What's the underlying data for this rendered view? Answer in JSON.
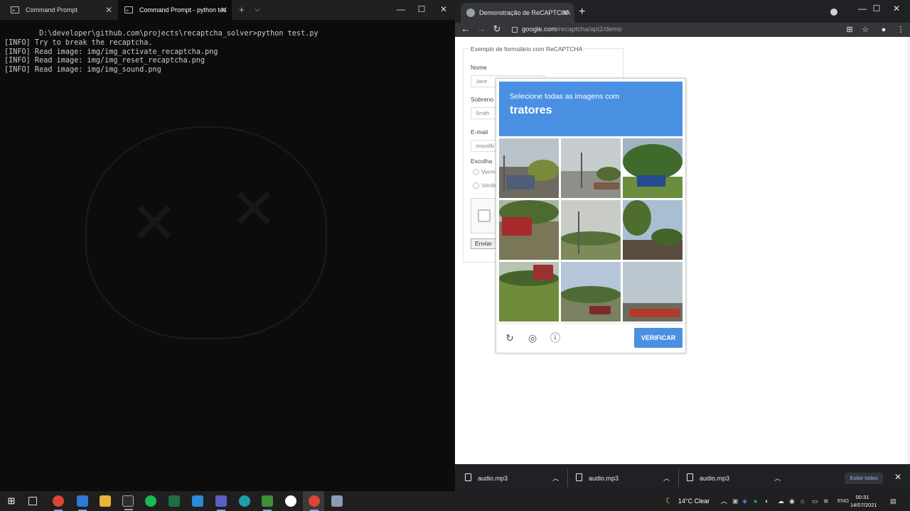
{
  "terminal": {
    "tabs": [
      {
        "label": "Command Prompt"
      },
      {
        "label": "Command Prompt - python  tes"
      }
    ],
    "lines": [
      "        D:\\developer\\github.com\\projects\\recaptcha_solver>python test.py",
      "[INFO] Try to break the recaptcha.",
      "[INFO] Read image: img/img_activate_recaptcha.png",
      "[INFO] Read image: img/img_reset_recaptcha.png",
      "[INFO] Read image: img/img_sound.png"
    ]
  },
  "browser": {
    "tab_title": "Demonstração de ReCAPTCHA",
    "url_host": "google.com",
    "url_path": "/recaptcha/api2/demo",
    "form": {
      "legend": "Exemplo de formulário com ReCAPTCHA",
      "name_label": "Nome",
      "name_value": "Jane",
      "surname_label": "Sobreno",
      "surname_value": "Smith",
      "email_label": "E-mail",
      "email_value": "stopallb",
      "choice_label": "Escolha",
      "radio1": "Verm",
      "radio2": "Verde",
      "submit": "Enviar"
    },
    "captcha": {
      "instruction": "Selecione todas as imagens com",
      "target": "tratores",
      "verify_label": "VERIFICAR",
      "accent": "#4a90e2"
    },
    "downloads": [
      {
        "name": "audio.mp3"
      },
      {
        "name": "audio.mp3"
      },
      {
        "name": "audio.mp3"
      }
    ],
    "show_all": "Exibir todos"
  },
  "taskbar": {
    "weather": "14°C  Clear",
    "lang": "ENG",
    "time": "00:31",
    "date": "14/07/2021"
  }
}
